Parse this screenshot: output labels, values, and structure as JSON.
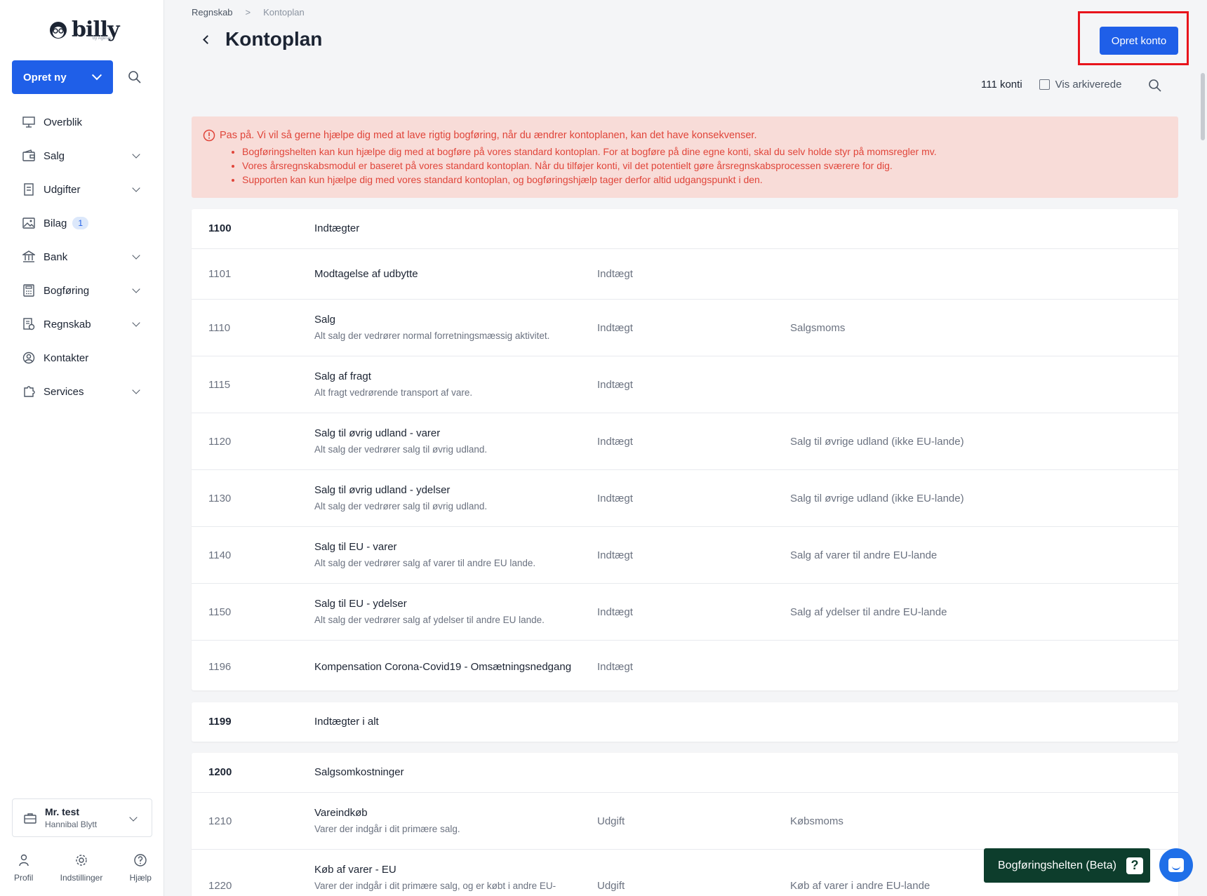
{
  "app": {
    "brand": "billy",
    "brand_sub": "by Ageras"
  },
  "sidebar": {
    "create_label": "Opret ny",
    "items": [
      {
        "label": "Overblik",
        "icon": "presentation-icon",
        "expandable": false
      },
      {
        "label": "Salg",
        "icon": "wallet-icon",
        "expandable": true
      },
      {
        "label": "Udgifter",
        "icon": "receipt-icon",
        "expandable": true
      },
      {
        "label": "Bilag",
        "icon": "image-icon",
        "expandable": false,
        "badge": "1"
      },
      {
        "label": "Bank",
        "icon": "bank-icon",
        "expandable": true
      },
      {
        "label": "Bogføring",
        "icon": "calculator-icon",
        "expandable": true
      },
      {
        "label": "Regnskab",
        "icon": "report-icon",
        "expandable": true
      },
      {
        "label": "Kontakter",
        "icon": "user-circle-icon",
        "expandable": false
      },
      {
        "label": "Services",
        "icon": "puzzle-icon",
        "expandable": true
      }
    ],
    "org": {
      "name": "Mr. test",
      "user": "Hannibal Blytt"
    },
    "bottom": {
      "profile": "Profil",
      "settings": "Indstillinger",
      "help": "Hjælp"
    }
  },
  "header": {
    "breadcrumb": [
      "Regnskab",
      "Kontoplan"
    ],
    "title": "Kontoplan",
    "create_account_label": "Opret konto",
    "count_label": "111 konti",
    "archived_label": "Vis arkiverede"
  },
  "alert": {
    "title": "Pas på. Vi vil så gerne hjælpe dig med at lave rigtig bogføring, når du ændrer kontoplanen, kan det have konsekvenser.",
    "bullets": [
      "Bogføringshelten kan kun hjælpe dig med at bogføre på vores standard kontoplan. For at bogføre på dine egne konti, skal du selv holde styr på momsregler mv.",
      "Vores årsregnskabsmodul er baseret på vores standard kontoplan. Når du tilføjer konti, vil det potentielt gøre årsregnskabsprocessen sværere for dig.",
      "Supporten kan kun hjælpe dig med vores standard kontoplan, og bogføringshjælp tager derfor altid udgangspunkt i den."
    ]
  },
  "groups": [
    {
      "header": {
        "no": "1100",
        "name": "Indtægter"
      },
      "rows": [
        {
          "no": "1101",
          "name": "Modtagelse af udbytte",
          "desc": "",
          "type": "Indtægt",
          "vat": ""
        },
        {
          "no": "1110",
          "name": "Salg",
          "desc": "Alt salg der vedrører normal forretningsmæssig aktivitet.",
          "type": "Indtægt",
          "vat": "Salgsmoms"
        },
        {
          "no": "1115",
          "name": "Salg af fragt",
          "desc": "Alt fragt vedrørende transport af vare.",
          "type": "Indtægt",
          "vat": ""
        },
        {
          "no": "1120",
          "name": "Salg til øvrig udland - varer",
          "desc": "Alt salg der vedrører salg til øvrig udland.",
          "type": "Indtægt",
          "vat": "Salg til øvrige udland (ikke EU-lande)"
        },
        {
          "no": "1130",
          "name": "Salg til øvrig udland - ydelser",
          "desc": "Alt salg der vedrører salg til øvrig udland.",
          "type": "Indtægt",
          "vat": "Salg til øvrige udland (ikke EU-lande)"
        },
        {
          "no": "1140",
          "name": "Salg til EU - varer",
          "desc": "Alt salg der vedrører salg af varer til andre EU lande.",
          "type": "Indtægt",
          "vat": "Salg af varer til andre EU-lande"
        },
        {
          "no": "1150",
          "name": "Salg til EU - ydelser",
          "desc": "Alt salg der vedrører salg af ydelser til andre EU lande.",
          "type": "Indtægt",
          "vat": "Salg af ydelser til andre EU-lande"
        },
        {
          "no": "1196",
          "name": "Kompensation Corona-Covid19 - Omsætningsnedgang",
          "desc": "",
          "type": "Indtægt",
          "vat": ""
        }
      ]
    },
    {
      "header": {
        "no": "1199",
        "name": "Indtægter i alt"
      },
      "rows": []
    },
    {
      "header": {
        "no": "1200",
        "name": "Salgsomkostninger"
      },
      "rows": [
        {
          "no": "1210",
          "name": "Vareindkøb",
          "desc": "Varer der indgår i dit primære salg.",
          "type": "Udgift",
          "vat": "Købsmoms"
        },
        {
          "no": "1220",
          "name": "Køb af varer - EU",
          "desc": "Varer der indgår i dit primære salg, og er købt i andre EU-",
          "type": "Udgift",
          "vat": "Køb af varer i andre EU-lande"
        }
      ]
    }
  ],
  "helper": {
    "label": "Bogføringshelten (Beta)"
  }
}
